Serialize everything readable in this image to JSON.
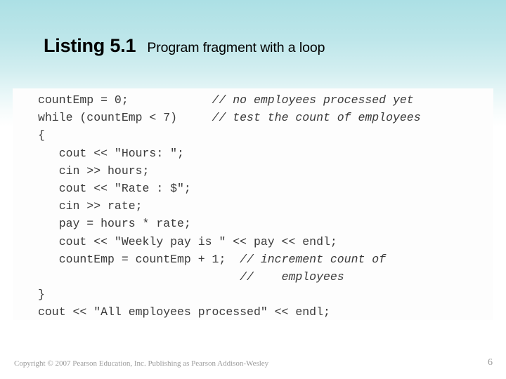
{
  "slide": {
    "background_top_color": "#ace0e5",
    "background_bottom_color": "#ffffff"
  },
  "title": {
    "main": "Listing 5.1",
    "subtitle": "Program fragment with a loop"
  },
  "code": {
    "language": "C++",
    "text_color": "#3a3a3a",
    "panel_color": "#fdfdfd",
    "lines": [
      "countEmp = 0;            // no employees processed yet",
      "while (countEmp < 7)     // test the count of employees",
      "{",
      "   cout << \"Hours: \";",
      "   cin >> hours;",
      "   cout << \"Rate : $\";",
      "   cin >> rate;",
      "   pay = hours * rate;",
      "   cout << \"Weekly pay is \" << pay << endl;",
      "   countEmp = countEmp + 1;  // increment count of",
      "                             //    employees",
      "}",
      "cout << \"All employees processed\" << endl;"
    ],
    "lines_parts": [
      {
        "code": "countEmp = 0;            ",
        "comment": "// no employees processed yet"
      },
      {
        "code": "while (countEmp < 7)     ",
        "comment": "// test the count of employees"
      },
      {
        "code": "{",
        "comment": ""
      },
      {
        "code": "   cout << \"Hours: \";",
        "comment": ""
      },
      {
        "code": "   cin >> hours;",
        "comment": ""
      },
      {
        "code": "   cout << \"Rate : $\";",
        "comment": ""
      },
      {
        "code": "   cin >> rate;",
        "comment": ""
      },
      {
        "code": "   pay = hours * rate;",
        "comment": ""
      },
      {
        "code": "   cout << \"Weekly pay is \" << pay << endl;",
        "comment": ""
      },
      {
        "code": "   countEmp = countEmp + 1;  ",
        "comment": "// increment count of"
      },
      {
        "code": "                             ",
        "comment": "//    employees"
      },
      {
        "code": "}",
        "comment": ""
      },
      {
        "code": "cout << \"All employees processed\" << endl;",
        "comment": ""
      }
    ]
  },
  "footer": {
    "copyright": "Copyright © 2007 Pearson Education, Inc. Publishing as Pearson Addison-Wesley",
    "page_number": "6",
    "text_color": "#9a9a9a"
  }
}
